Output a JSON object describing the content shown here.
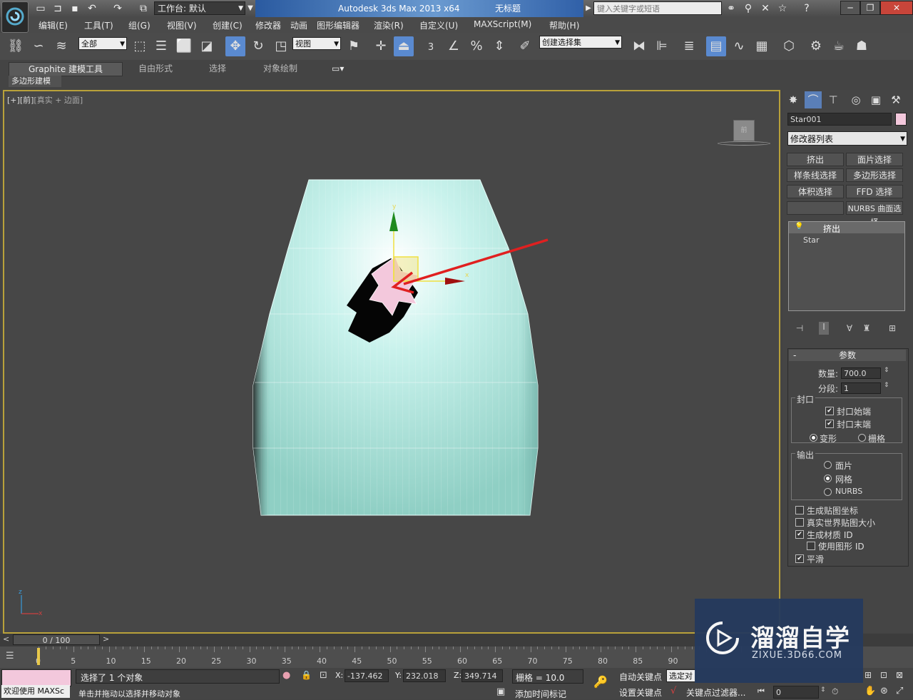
{
  "titlebar": {
    "workspace_label": "工作台: 默认",
    "app_name": "Autodesk 3ds Max  2013 x64",
    "doc_name": "无标题",
    "search_placeholder": "键入关键字或短语"
  },
  "menu": [
    "编辑(E)",
    "工具(T)",
    "组(G)",
    "视图(V)",
    "创建(C)",
    "修改器",
    "动画",
    "图形编辑器",
    "渲染(R)",
    "自定义(U)",
    "MAXScript(M)",
    "帮助(H)"
  ],
  "toolbar": {
    "filter": "全部",
    "ref_coord": "视图",
    "snap_3": "3",
    "named_selection": "创建选择集"
  },
  "ribbon": {
    "tabs": [
      "Graphite 建模工具",
      "自由形式",
      "选择",
      "对象绘制"
    ],
    "subtab": "多边形建模"
  },
  "viewport": {
    "label_plus": "[+]",
    "label_front": "[前]",
    "label_mode": "[真实 + 边面]",
    "viewcube_face": "前",
    "gizmo_x": "x",
    "gizmo_y": "y",
    "axis_z": "z",
    "axis_x": "x"
  },
  "command_panel": {
    "object_name": "Star001",
    "object_color": "#f3c8dc",
    "modifier_list": "修改器列表",
    "mod_buttons": [
      "挤出",
      "面片选择",
      "样条线选择",
      "多边形选择",
      "体积选择",
      "FFD 选择",
      "",
      "NURBS 曲面选择"
    ],
    "stack_items": [
      "挤出",
      "Star"
    ],
    "params_title": "参数",
    "amount_label": "数量:",
    "amount_value": "700.0",
    "segments_label": "分段:",
    "segments_value": "1",
    "capping_title": "封口",
    "cap_start": "封口始端",
    "cap_end": "封口末端",
    "morph": "变形",
    "grid": "栅格",
    "output_title": "输出",
    "out_patch": "面片",
    "out_mesh": "网格",
    "out_nurbs": "NURBS",
    "gen_map": "生成贴图坐标",
    "real_world": "真实世界贴图大小",
    "gen_mat": "生成材质 ID",
    "use_shape": "使用图形 ID",
    "smooth": "平滑"
  },
  "timeline": {
    "frame": "0 / 100",
    "ticks": [
      "0",
      "5",
      "10",
      "15",
      "20",
      "25",
      "30",
      "35",
      "40",
      "45",
      "50",
      "55",
      "60",
      "65",
      "70",
      "75",
      "80",
      "85",
      "90"
    ]
  },
  "status": {
    "maxscript": "欢迎使用 MAXSc",
    "selected": "选择了 1 个对象",
    "prompt": "单击并拖动以选择并移动对象",
    "x_label": "X:",
    "x_value": "-137.462",
    "y_label": "Y:",
    "y_value": "232.018",
    "z_label": "Z:",
    "z_value": "349.714",
    "grid": "栅格 = 10.0",
    "auto_key": "自动关键点",
    "selected_obj": "选定对",
    "set_key": "设置关键点",
    "key_filters": "关键点过滤器...",
    "add_time_tag": "添加时间标记",
    "frame_field": "0"
  },
  "watermark": {
    "brand": "溜溜自学",
    "url": "ZIXUE.3D66.COM"
  }
}
